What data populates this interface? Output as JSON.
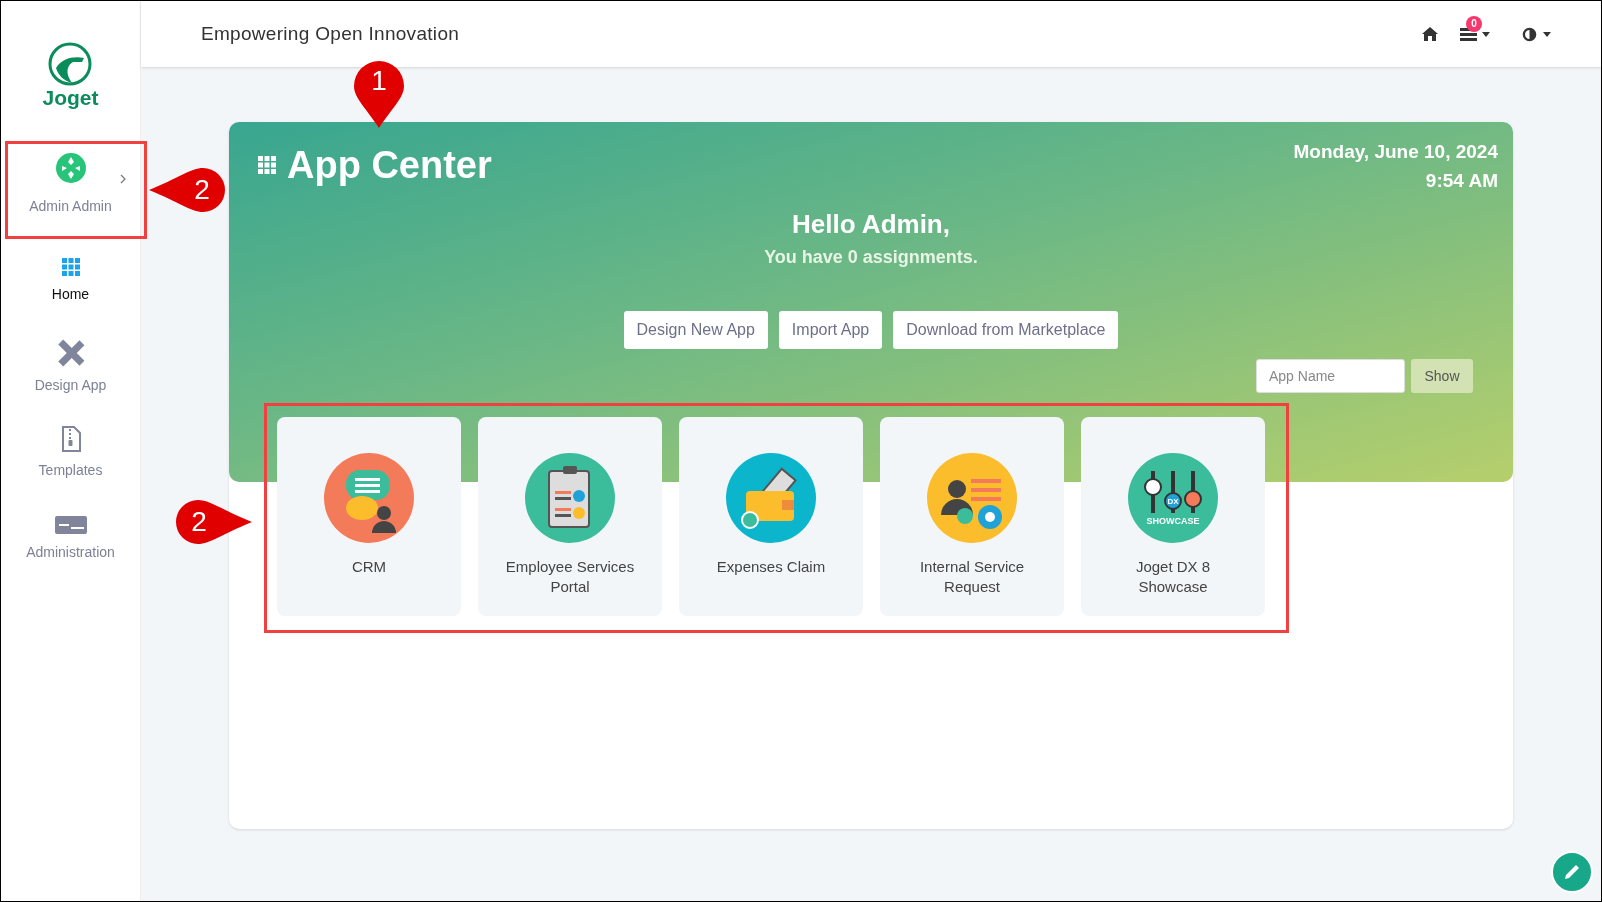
{
  "header": {
    "title": "Empowering Open Innovation",
    "task_count": "0"
  },
  "sidebar": {
    "logo_text": "Joget",
    "user": {
      "name": "Admin Admin"
    },
    "items": [
      {
        "label": "Home",
        "kind": "home",
        "selected": true
      },
      {
        "label": "Design App",
        "kind": "design",
        "selected": false
      },
      {
        "label": "Templates",
        "kind": "templates",
        "selected": false
      },
      {
        "label": "Administration",
        "kind": "admin",
        "selected": false
      }
    ]
  },
  "app_center": {
    "title": "App Center",
    "date": "Monday, June 10, 2024",
    "time": "9:54 AM",
    "greeting": "Hello Admin,",
    "assignments": "You have 0 assignments.",
    "buttons": [
      "Design New App",
      "Import App",
      "Download from Marketplace"
    ],
    "search": {
      "placeholder": "App Name",
      "button": "Show"
    },
    "apps": [
      {
        "name": "CRM",
        "kind": "crm"
      },
      {
        "name": "Employee Services Portal",
        "kind": "portal"
      },
      {
        "name": "Expenses Claim",
        "kind": "claim"
      },
      {
        "name": "Internal Service Request",
        "kind": "request"
      },
      {
        "name": "Joget DX 8 Showcase",
        "kind": "showcase",
        "badge": "DX",
        "caption": "SHOWCASE"
      }
    ]
  },
  "annotations": [
    {
      "label": "1",
      "kind": "down"
    },
    {
      "label": "2",
      "kind": "left"
    },
    {
      "label": "2",
      "kind": "right"
    }
  ]
}
